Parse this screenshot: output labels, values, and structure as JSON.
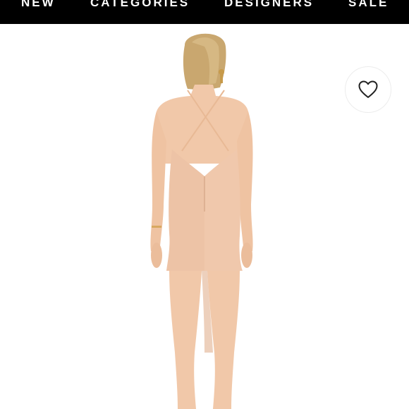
{
  "nav": {
    "items": [
      {
        "label": "NEW"
      },
      {
        "label": "CATEGORIES"
      },
      {
        "label": "DESIGNERS"
      },
      {
        "label": "SALE"
      }
    ]
  },
  "product": {
    "dress_color": "#f0c8ac",
    "skin_color": "#f1c8a9",
    "hair_color": "#c9a76f"
  },
  "favorite": {
    "icon": "heart-icon"
  },
  "colors": {
    "nav_background": "#000000",
    "nav_text": "#ffffff",
    "page_background": "#ffffff"
  }
}
